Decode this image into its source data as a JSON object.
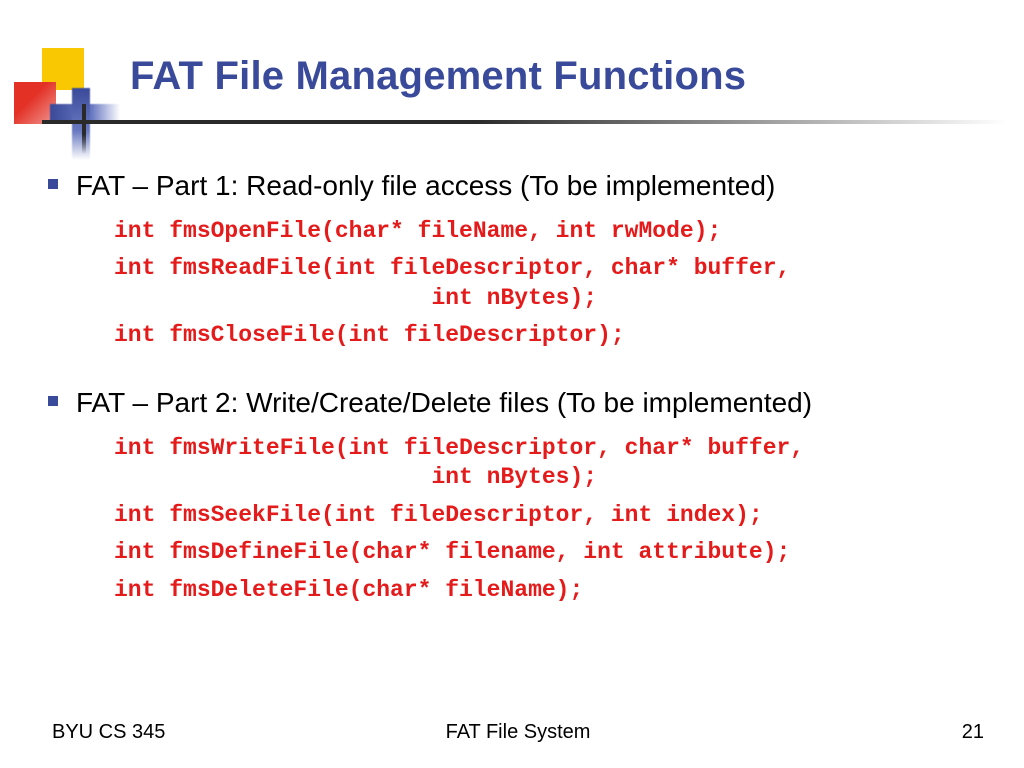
{
  "title": "FAT File Management Functions",
  "sections": [
    {
      "bullet": "FAT – Part 1: Read-only file access (To be implemented)",
      "code": [
        "int fmsOpenFile(char* fileName, int rwMode);",
        "int fmsReadFile(int fileDescriptor, char* buffer,\n                       int nBytes);",
        "int fmsCloseFile(int fileDescriptor);"
      ]
    },
    {
      "bullet": "FAT – Part 2: Write/Create/Delete files (To be implemented)",
      "code": [
        "int fmsWriteFile(int fileDescriptor, char* buffer,\n                       int nBytes);",
        "int fmsSeekFile(int fileDescriptor, int index);",
        "int fmsDefineFile(char* filename, int attribute);",
        "int fmsDeleteFile(char* fileName);"
      ]
    }
  ],
  "footer": {
    "left": "BYU CS 345",
    "center": "FAT File System",
    "right": "21"
  }
}
